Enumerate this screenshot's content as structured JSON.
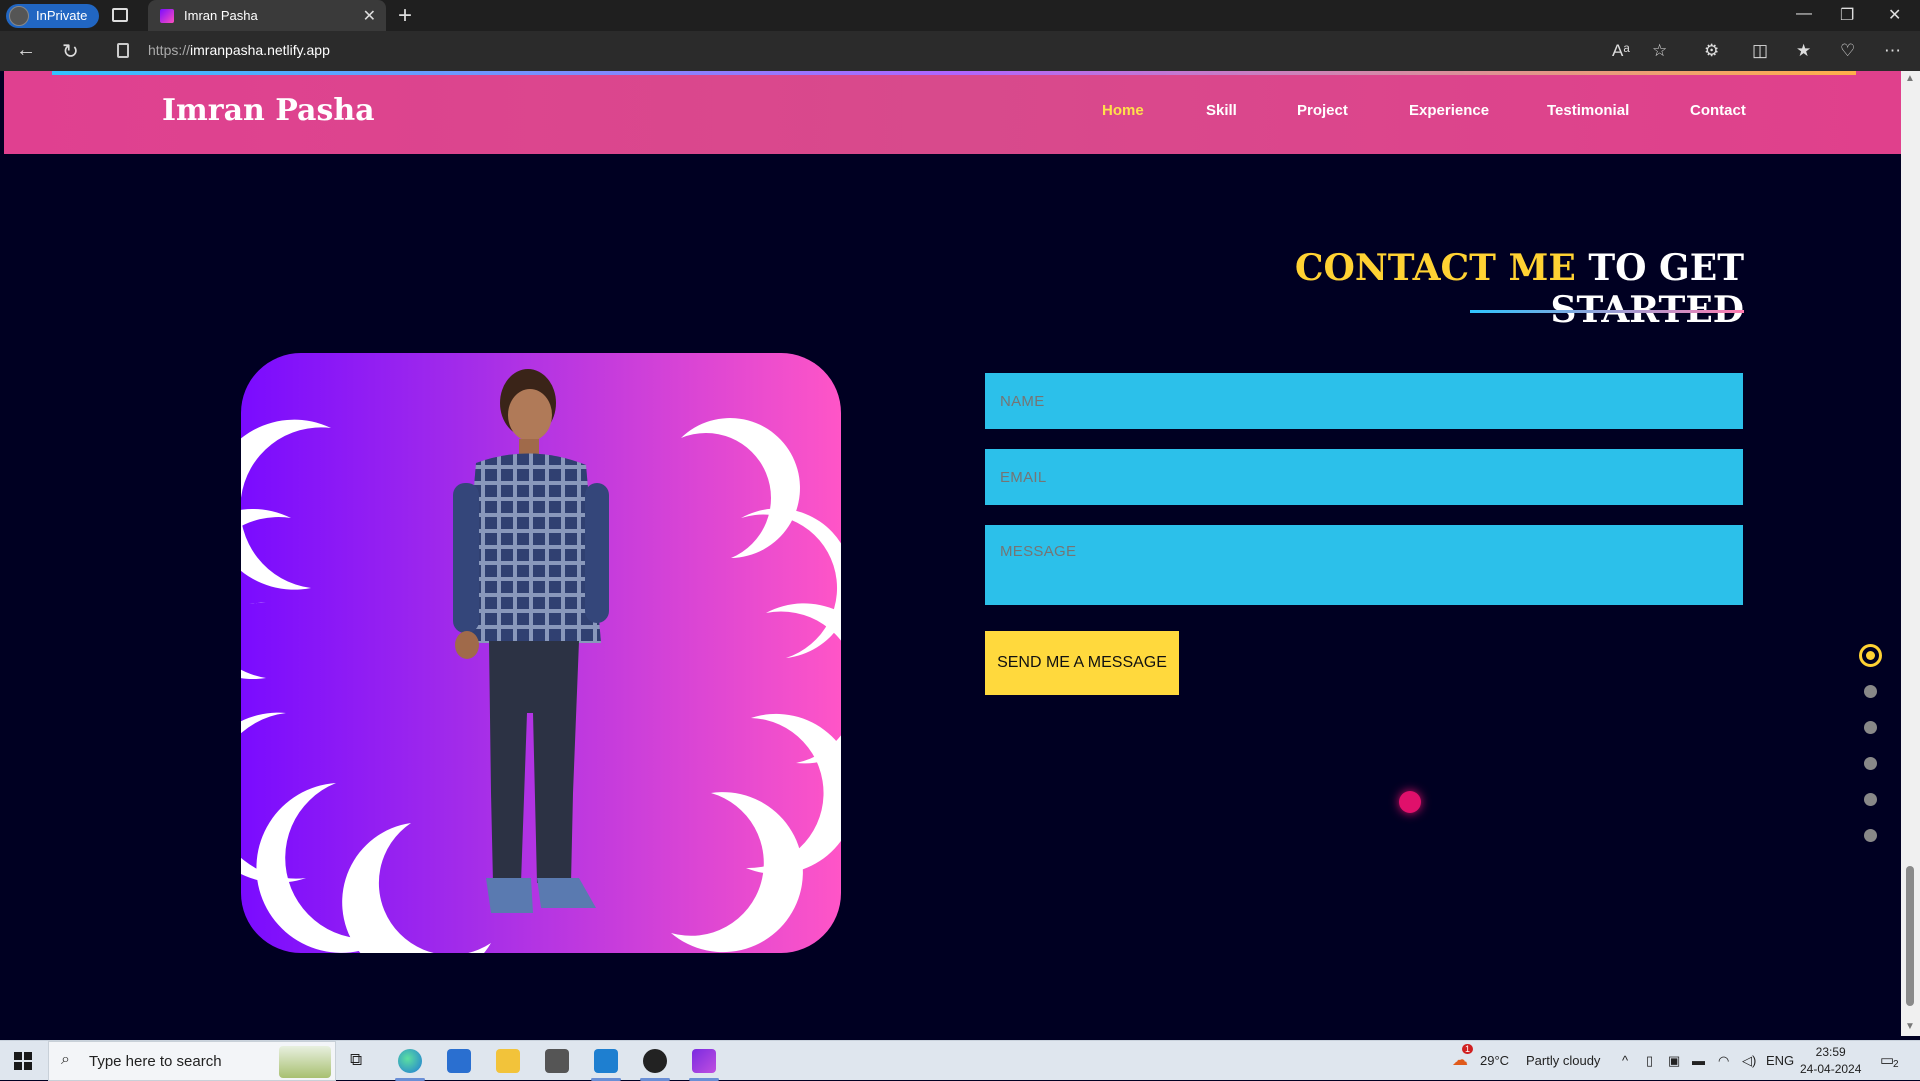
{
  "browser": {
    "inprivate_label": "InPrivate",
    "tab_title": "Imran Pasha",
    "url_prefix": "https://",
    "url_host": "imranpasha.netlify.app"
  },
  "site": {
    "brand": "Imran Pasha",
    "nav": [
      "Home",
      "Skill",
      "Project",
      "Experience",
      "Testimonial",
      "Contact"
    ],
    "active_nav": "Home"
  },
  "contact": {
    "heading_highlight": "CONTACT ME",
    "heading_rest": "TO GET STARTED",
    "name_placeholder": "NAME",
    "email_placeholder": "EMAIL",
    "message_placeholder": "MESSAGE",
    "send_label": "SEND ME A MESSAGE"
  },
  "side_nav": {
    "count": 6,
    "active_index": 0
  },
  "taskbar": {
    "search_placeholder": "Type here to search",
    "weather_temp": "29°C",
    "weather_text": "Partly cloudy",
    "weather_alert": "1",
    "lang": "ENG",
    "time": "23:59",
    "date": "24-04-2024",
    "notifications": "2"
  },
  "colors": {
    "accent_yellow": "#ffd233",
    "header_pink": "#d84a8c",
    "field_cyan": "#2cc0ea",
    "page_bg": "#000022"
  }
}
